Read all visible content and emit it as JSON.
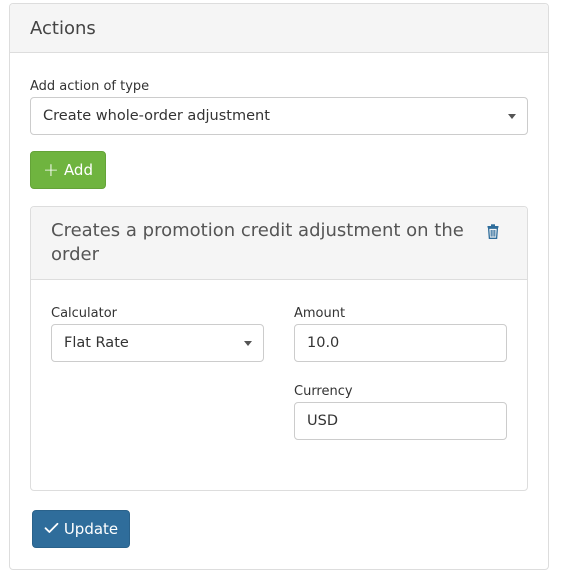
{
  "panel": {
    "title": "Actions",
    "add_action_label": "Add action of type",
    "add_action_selected": "Create whole-order adjustment",
    "add_button_label": "Add"
  },
  "action": {
    "title": "Creates a promotion credit adjustment on the order",
    "calculator_label": "Calculator",
    "calculator_selected": "Flat Rate",
    "amount_label": "Amount",
    "amount_value": "10.0",
    "currency_label": "Currency",
    "currency_value": "USD"
  },
  "update_button_label": "Update",
  "colors": {
    "add_button": "#6fb43f",
    "update_button": "#2f6d9b",
    "trash_icon": "#2f6d9b"
  }
}
